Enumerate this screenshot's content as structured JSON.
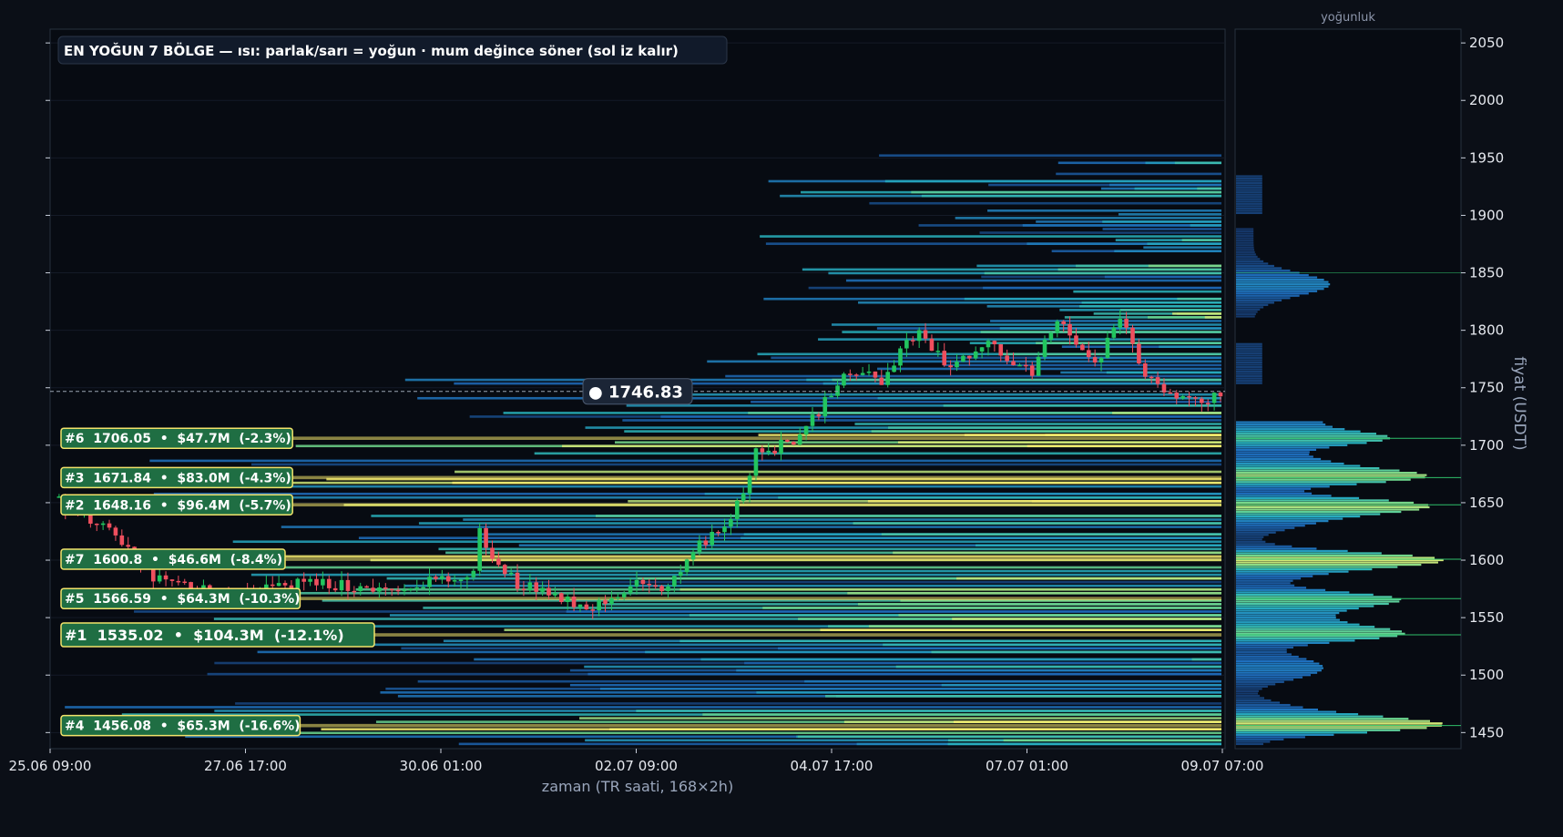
{
  "chart": {
    "title": "EN YOĞUN 7 BÖLGE — ısı: parlak/sarı = yoğun · mum değince söner (sol iz kalır)",
    "xlabel": "zaman (TR saati, 168×2h)",
    "ylabel": "fiyat (USDT)",
    "side_title": "yoğunluk",
    "current_price_label": "● 1746.83"
  },
  "chart_data": {
    "type": "candlestick-heatmap",
    "title": "EN YOĞUN 7 BÖLGE — ısı: parlak/sarı = yoğun · mum değince söner (sol iz kalır)",
    "xlabel": "zaman (TR saati, 168×2h)",
    "ylabel": "fiyat (USDT)",
    "x_ticks": [
      "25.06 09:00",
      "27.06 17:00",
      "30.06 01:00",
      "02.07 09:00",
      "04.07 17:00",
      "07.07 01:00",
      "09.07 07:00"
    ],
    "ylim": [
      1436,
      2062
    ],
    "y_ticks": [
      1450,
      1500,
      1550,
      1600,
      1650,
      1700,
      1750,
      1800,
      1850,
      1900,
      1950,
      2000,
      2050
    ],
    "current_price": 1746.83,
    "zones": [
      {
        "rank": 6,
        "price": 1706.05,
        "label": "#6  1706.05  •  $47.7M  (-2.3%)"
      },
      {
        "rank": 3,
        "price": 1671.84,
        "label": "#3  1671.84  •  $83.0M  (-4.3%)"
      },
      {
        "rank": 2,
        "price": 1648.16,
        "label": "#2  1648.16  •  $96.4M  (-5.7%)"
      },
      {
        "rank": 7,
        "price": 1600.8,
        "label": "#7  1600.8  •  $46.6M  (-8.4%)"
      },
      {
        "rank": 5,
        "price": 1566.59,
        "label": "#5  1566.59  •  $64.3M  (-10.3%)"
      },
      {
        "rank": 1,
        "price": 1535.02,
        "label": "#1  1535.02  •  $104.3M  (-12.1%)"
      },
      {
        "rank": 4,
        "price": 1456.08,
        "label": "#4  1456.08  •  $65.3M  (-16.6%)"
      }
    ],
    "candles_close_path": [
      [
        0,
        1655
      ],
      [
        4,
        1640
      ],
      [
        8,
        1628
      ],
      [
        12,
        1610
      ],
      [
        16,
        1585
      ],
      [
        22,
        1575
      ],
      [
        28,
        1572
      ],
      [
        34,
        1576
      ],
      [
        40,
        1580
      ],
      [
        46,
        1578
      ],
      [
        52,
        1575
      ],
      [
        56,
        1570
      ],
      [
        60,
        1585
      ],
      [
        64,
        1580
      ],
      [
        67,
        1590
      ],
      [
        68,
        1625
      ],
      [
        70,
        1600
      ],
      [
        74,
        1580
      ],
      [
        78,
        1575
      ],
      [
        82,
        1565
      ],
      [
        86,
        1560
      ],
      [
        90,
        1572
      ],
      [
        94,
        1580
      ],
      [
        98,
        1575
      ],
      [
        100,
        1590
      ],
      [
        102,
        1610
      ],
      [
        104,
        1615
      ],
      [
        106,
        1625
      ],
      [
        108,
        1640
      ],
      [
        110,
        1655
      ],
      [
        112,
        1700
      ],
      [
        114,
        1695
      ],
      [
        116,
        1700
      ],
      [
        118,
        1705
      ],
      [
        120,
        1715
      ],
      [
        122,
        1730
      ],
      [
        124,
        1745
      ],
      [
        126,
        1758
      ],
      [
        128,
        1765
      ],
      [
        130,
        1760
      ],
      [
        132,
        1755
      ],
      [
        134,
        1770
      ],
      [
        136,
        1790
      ],
      [
        138,
        1798
      ],
      [
        140,
        1785
      ],
      [
        142,
        1772
      ],
      [
        144,
        1770
      ],
      [
        146,
        1780
      ],
      [
        148,
        1790
      ],
      [
        150,
        1785
      ],
      [
        152,
        1778
      ],
      [
        154,
        1770
      ],
      [
        156,
        1760
      ],
      [
        158,
        1795
      ],
      [
        160,
        1808
      ],
      [
        162,
        1800
      ],
      [
        164,
        1780
      ],
      [
        166,
        1768
      ],
      [
        168,
        1790
      ],
      [
        170,
        1805
      ],
      [
        172,
        1790
      ],
      [
        174,
        1760
      ],
      [
        176,
        1755
      ],
      [
        178,
        1745
      ],
      [
        180,
        1738
      ],
      [
        182,
        1742
      ],
      [
        184,
        1740
      ],
      [
        186,
        1746.83
      ]
    ]
  },
  "colors": {
    "background": "#0b0f17",
    "candle_up": "#22c55e",
    "candle_down": "#ef4f5e",
    "zone_badge": "#1f6e43",
    "zone_border": "#f2e36b"
  }
}
